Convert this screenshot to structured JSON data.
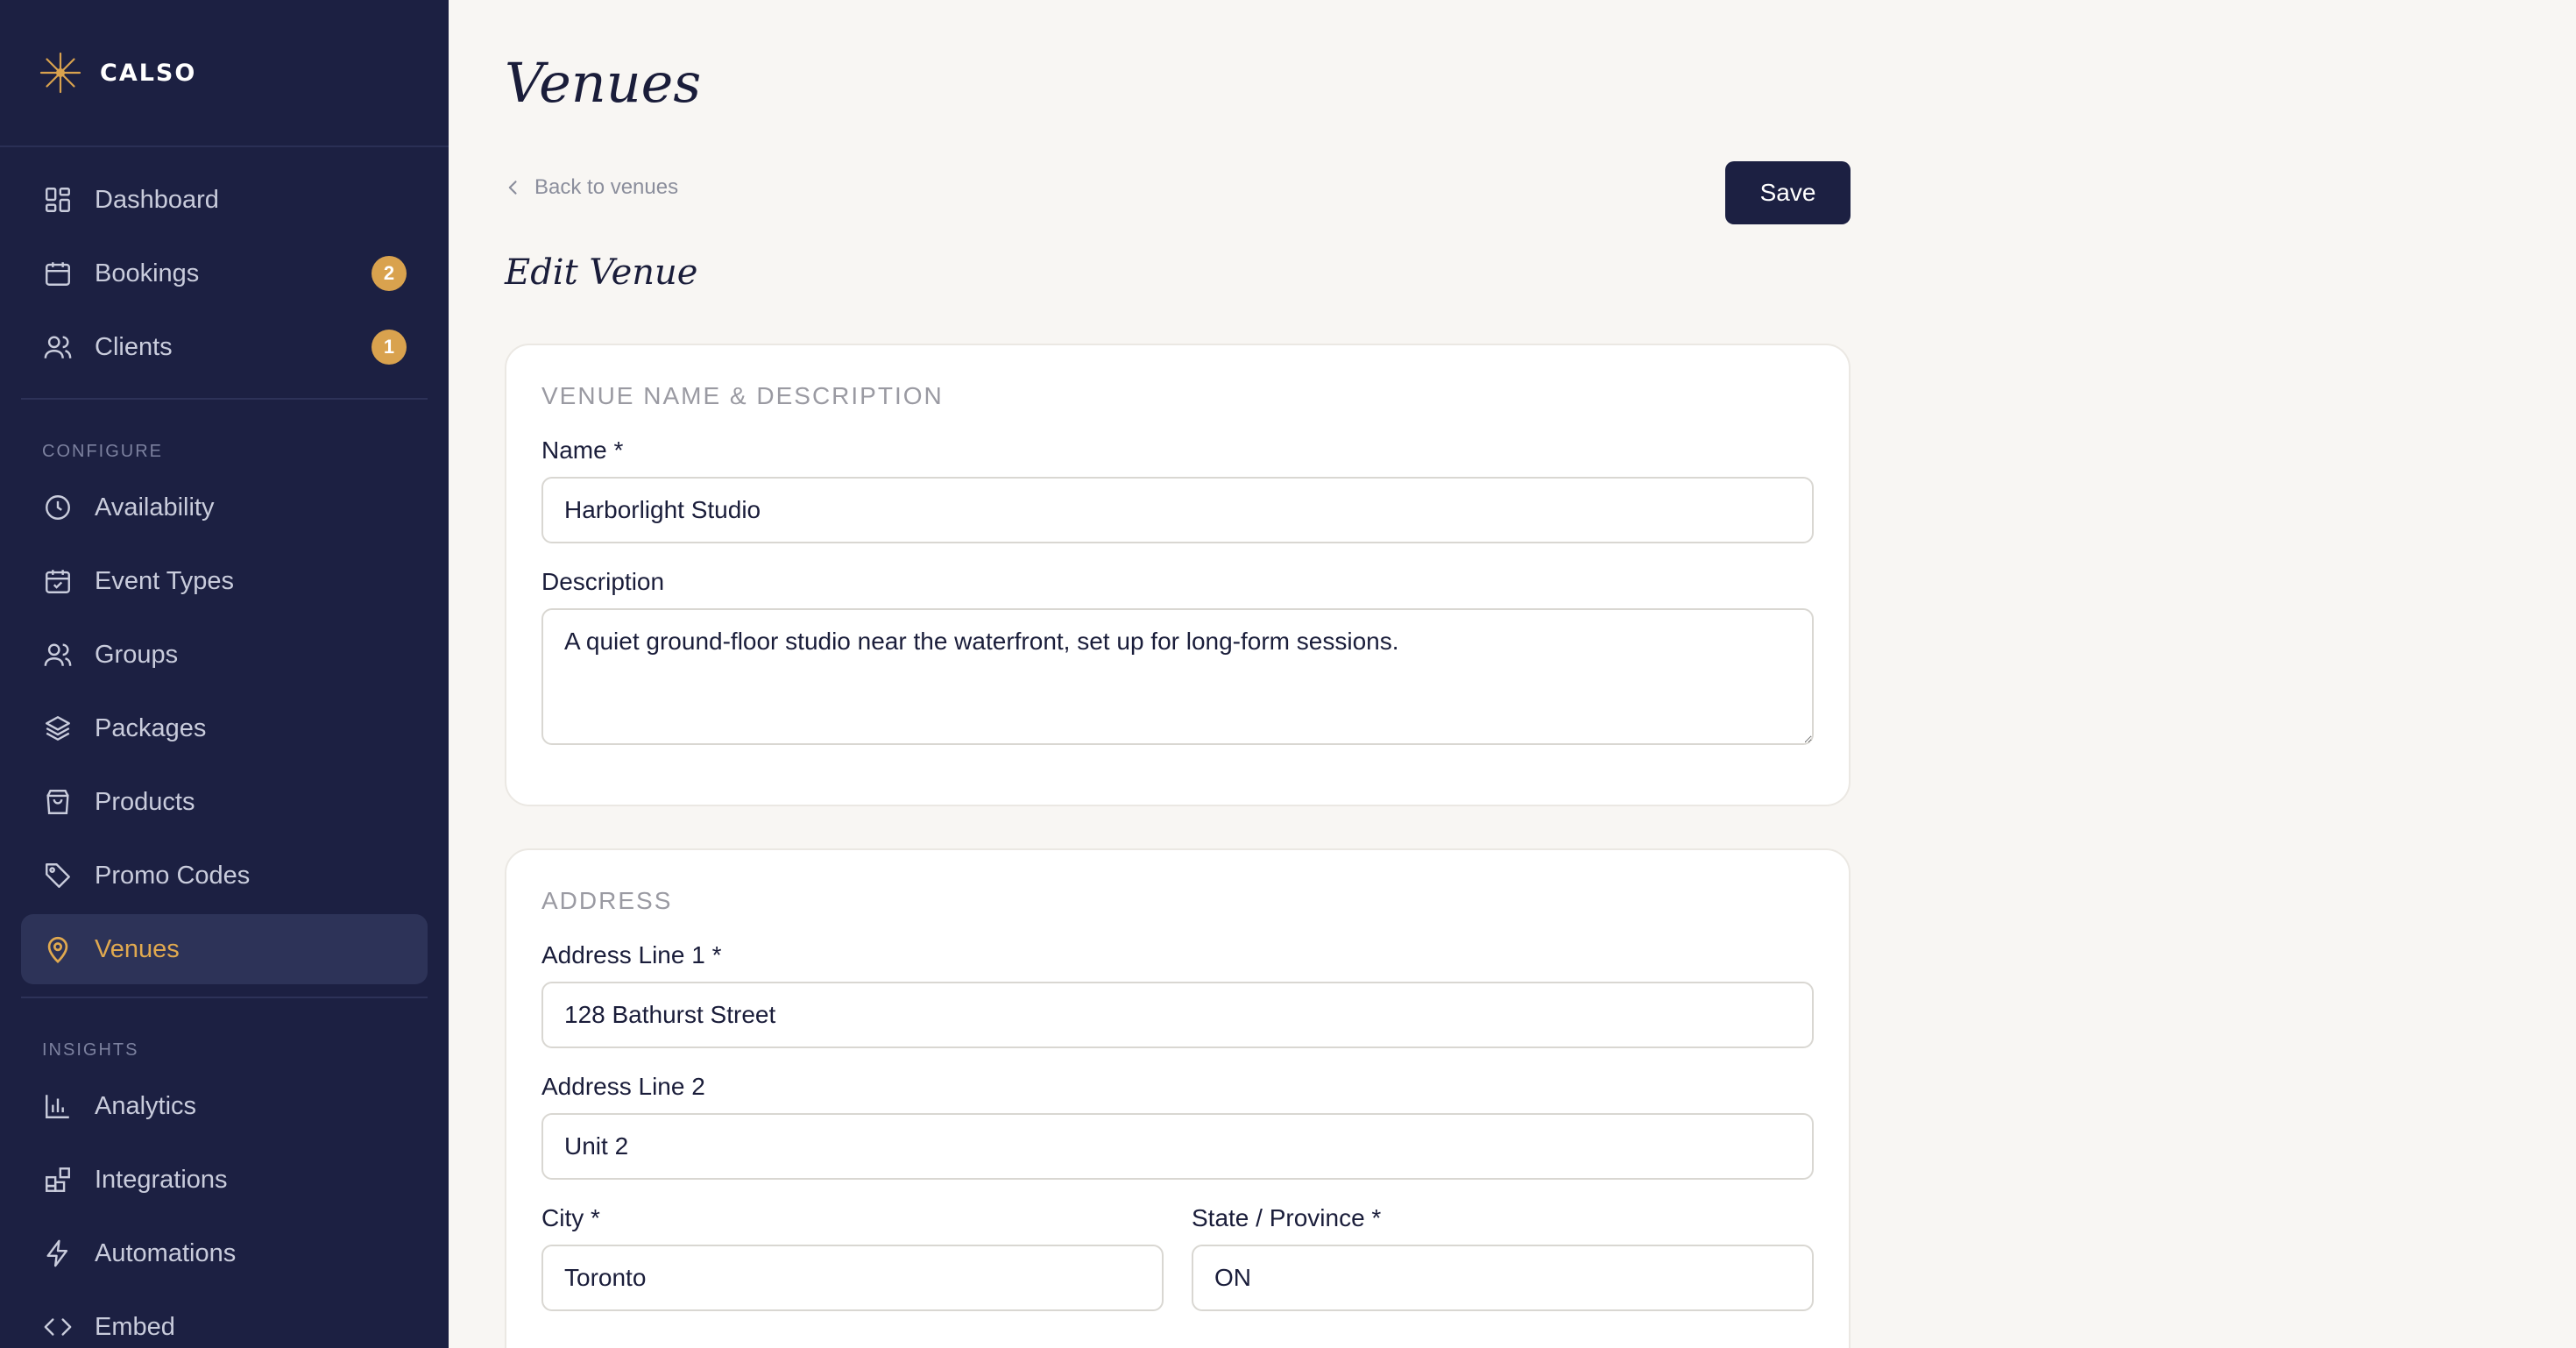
{
  "brand": {
    "name": "CALSO",
    "icon": "sun-burst-icon",
    "accent": "#d9a24e"
  },
  "sidebar": {
    "main_items": [
      {
        "label": "Dashboard",
        "icon": "dashboard-grid-icon"
      },
      {
        "label": "Bookings",
        "icon": "calendar-icon",
        "badge": "2"
      },
      {
        "label": "Clients",
        "icon": "users-icon",
        "badge": "1"
      }
    ],
    "configure_label": "CONFIGURE",
    "configure_items": [
      {
        "label": "Availability",
        "icon": "clock-icon"
      },
      {
        "label": "Event Types",
        "icon": "calendar-check-icon"
      },
      {
        "label": "Groups",
        "icon": "group-icon"
      },
      {
        "label": "Packages",
        "icon": "layers-icon"
      },
      {
        "label": "Products",
        "icon": "shopping-bag-icon"
      },
      {
        "label": "Promo Codes",
        "icon": "tag-icon"
      },
      {
        "label": "Venues",
        "icon": "map-pin-icon",
        "active": true
      }
    ],
    "insights_label": "INSIGHTS",
    "insights_items": [
      {
        "label": "Analytics",
        "icon": "bar-chart-icon"
      },
      {
        "label": "Integrations",
        "icon": "integrations-icon"
      },
      {
        "label": "Automations",
        "icon": "lightning-icon"
      },
      {
        "label": "Embed",
        "icon": "code-icon"
      }
    ]
  },
  "page": {
    "title": "Venues",
    "back_label": "Back to venues",
    "save_label": "Save",
    "section_title": "Edit Venue"
  },
  "form": {
    "name_section": {
      "heading": "VENUE NAME & DESCRIPTION",
      "name_label": "Name *",
      "name_value": "Harborlight Studio",
      "description_label": "Description",
      "description_value": "A quiet ground-floor studio near the waterfront, set up for long-form sessions."
    },
    "address_section": {
      "heading": "ADDRESS",
      "line1_label": "Address Line 1 *",
      "line1_value": "128 Bathurst Street",
      "line2_label": "Address Line 2",
      "line2_value": "Unit 2",
      "city_label": "City *",
      "city_value": "Toronto",
      "state_label": "State / Province *",
      "state_value": "ON"
    }
  }
}
